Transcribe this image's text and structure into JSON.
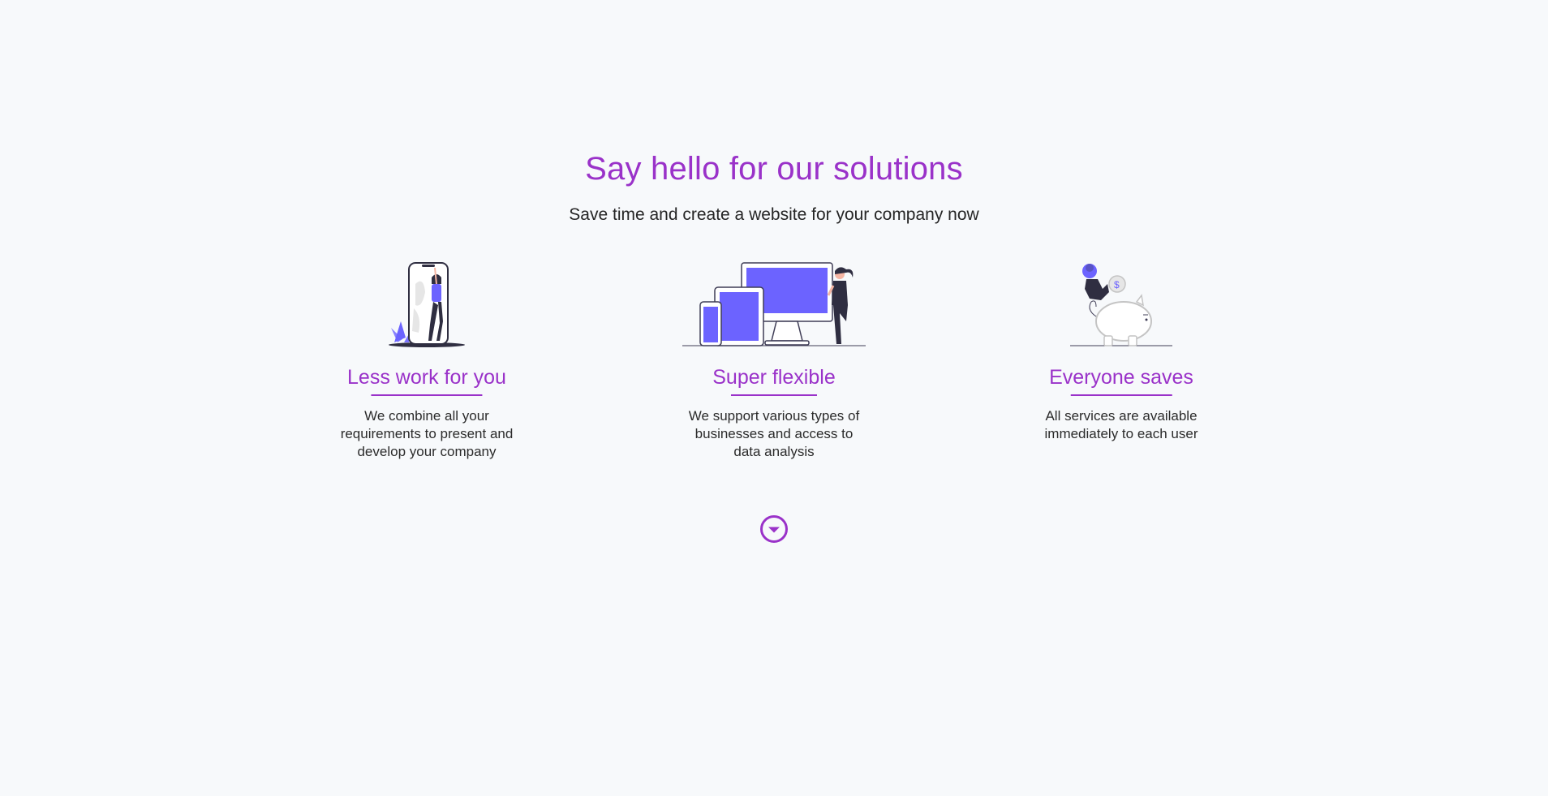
{
  "section": {
    "title": "Say hello for our solutions",
    "subtitle": "Save time and create a website for your company now"
  },
  "features": [
    {
      "title": "Less work for you",
      "text": "We combine all your requirements to present and develop your company",
      "illustration": "woman-with-phone-illustration"
    },
    {
      "title": "Super flexible",
      "text": "We support various types of businesses and access to data analysis",
      "illustration": "devices-illustration"
    },
    {
      "title": "Everyone saves",
      "text": "All services are available immediately to each user",
      "illustration": "piggy-bank-illustration"
    }
  ],
  "scroll_button": {
    "icon": "chevron-down-circle-icon"
  },
  "colors": {
    "accent": "#9a32c9",
    "illustration": "#6c63ff",
    "background": "#f7f9fb",
    "text": "#2b2b2b"
  }
}
